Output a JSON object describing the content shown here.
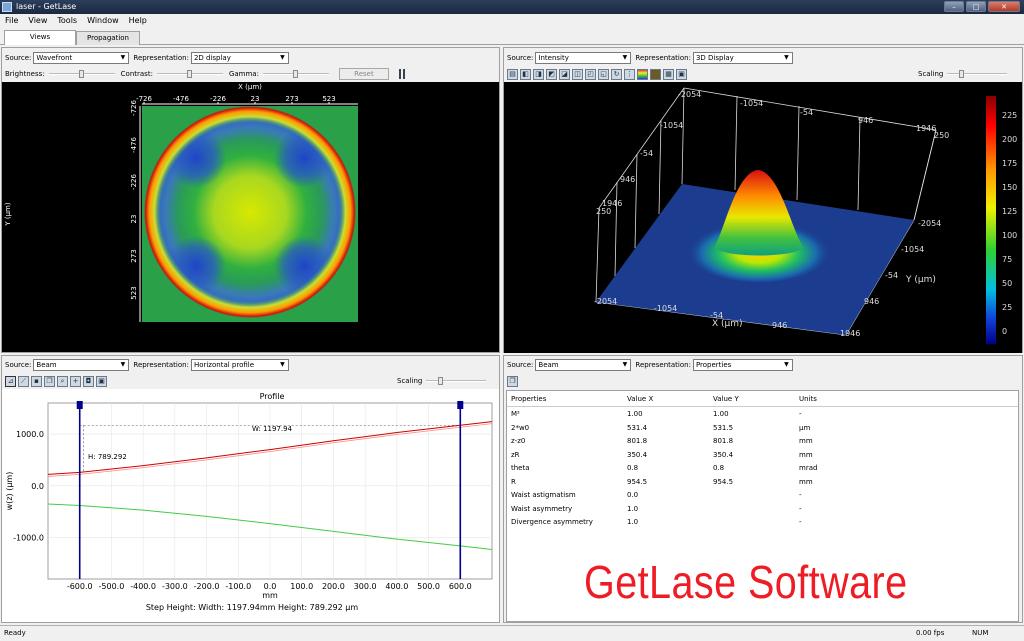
{
  "window": {
    "title": "laser - GetLase"
  },
  "menu": [
    "File",
    "View",
    "Tools",
    "Window",
    "Help"
  ],
  "tabs": [
    {
      "label": "Views"
    },
    {
      "label": "Propagation"
    }
  ],
  "pane_tl": {
    "source_label": "Source:",
    "source_value": "Wavefront",
    "rep_label": "Representation:",
    "rep_value": "2D display",
    "brightness_label": "Brightness:",
    "contrast_label": "Contrast:",
    "gamma_label": "Gamma:",
    "reset_label": "Reset",
    "x_axis_title": "X (µm)",
    "y_axis_title": "Y (µm)",
    "x_ticks": [
      "-726",
      "-476",
      "-226",
      "23",
      "273",
      "523"
    ],
    "y_ticks": [
      "-726",
      "-476",
      "-226",
      "23",
      "273",
      "523"
    ]
  },
  "pane_tr": {
    "source_label": "Source:",
    "source_value": "Intensity",
    "rep_label": "Representation:",
    "rep_value": "3D Display",
    "scaling_label": "Scaling",
    "axis_labels": {
      "x": "X (µm)",
      "y": "Y (µm)"
    },
    "back_x_ticks": [
      "-2054",
      "-1054",
      "-54",
      "946",
      "1946"
    ],
    "left_ticks": [
      "-1054",
      "-54",
      "946",
      "1946"
    ],
    "z_top_label": "250",
    "right_y_ticks": [
      "-2054",
      "-1054",
      "-54",
      "946"
    ],
    "front_x_ticks": [
      "-1054",
      "-54",
      "946",
      "1946"
    ],
    "corner_front": "-2054",
    "colorbar_ticks": [
      "225",
      "200",
      "175",
      "150",
      "125",
      "100",
      "75",
      "50",
      "25",
      "0"
    ]
  },
  "pane_bl": {
    "source_label": "Source:",
    "source_value": "Beam",
    "rep_label": "Representation:",
    "rep_value": "Horizontal profile",
    "scaling_label": "Scaling",
    "chart_title": "Profile",
    "ylabel": "w(z) (µm)",
    "xlabel": "mm",
    "width_label": "W: 1197.94",
    "height_label": "H: 789.292",
    "footer": "Step Height: Width: 1197.94mm Height: 789.292 µm"
  },
  "chart_data": {
    "type": "line",
    "title": "Profile",
    "xlabel": "mm",
    "ylabel": "w(z) (µm)",
    "x_ticks": [
      -600.0,
      -500.0,
      -400.0,
      -300.0,
      -200.0,
      -100.0,
      0.0,
      100.0,
      200.0,
      300.0,
      400.0,
      500.0,
      600.0
    ],
    "y_ticks": [
      1000.0,
      0.0,
      -1000.0
    ],
    "x_tick_labels": [
      "-600.0",
      "-500.0",
      "-400.0",
      "-300.0",
      "-200.0",
      "-100.0",
      "0.0",
      "100.0",
      "200.0",
      "300.0",
      "400.0",
      "500.0",
      "600.0"
    ],
    "y_tick_labels": [
      "1000.0",
      "0.0",
      "-1000.0"
    ],
    "xlim": [
      -700,
      700
    ],
    "ylim": [
      -1800,
      1600
    ],
    "grid": true,
    "series": [
      {
        "color": "#cc0000",
        "x": [
          -700,
          -600,
          -400,
          -200,
          0,
          200,
          400,
          600,
          700
        ],
        "values": [
          220,
          260,
          390,
          540,
          700,
          870,
          1030,
          1170,
          1240
        ]
      },
      {
        "color": "#44cc44",
        "x": [
          -700,
          -600,
          -400,
          -200,
          0,
          200,
          400,
          600,
          700
        ],
        "values": [
          -350,
          -380,
          -470,
          -590,
          -730,
          -880,
          -1030,
          -1160,
          -1230
        ]
      }
    ],
    "markers": [
      -600,
      600
    ]
  },
  "pane_br": {
    "source_label": "Source:",
    "source_value": "Beam",
    "rep_label": "Representation:",
    "rep_value": "Properties",
    "headers": [
      "Properties",
      "Value X",
      "Value Y",
      "Units"
    ],
    "rows": [
      [
        "M²",
        "1.00",
        "1.00",
        "-"
      ],
      [
        "2*w0",
        "531.4",
        "531.5",
        "µm"
      ],
      [
        "z-z0",
        "801.8",
        "801.8",
        "mm"
      ],
      [
        "zR",
        "350.4",
        "350.4",
        "mm"
      ],
      [
        "theta",
        "0.8",
        "0.8",
        "mrad"
      ],
      [
        "R",
        "954.5",
        "954.5",
        "mm"
      ],
      [
        "Waist astigmatism",
        "0.0",
        "",
        "-"
      ],
      [
        "Waist asymmetry",
        "1.0",
        "",
        "-"
      ],
      [
        "Divergence asymmetry",
        "1.0",
        "",
        "-"
      ]
    ]
  },
  "brand_text": "GetLase Software",
  "status": {
    "left": "Ready",
    "fps": "0.00 fps",
    "num": "NUM"
  }
}
